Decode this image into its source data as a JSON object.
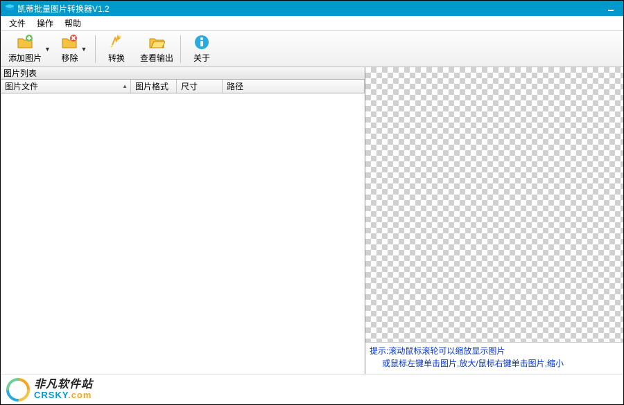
{
  "title": "凯蒂批量图片转换器V1.2",
  "menu": {
    "file": "文件",
    "operate": "操作",
    "help": "帮助"
  },
  "toolbar": {
    "add": "添加图片",
    "remove": "移除",
    "convert": "转换",
    "viewOutput": "查看输出",
    "about": "关于"
  },
  "panel": {
    "listTitle": "图片列表"
  },
  "columns": {
    "file": "图片文件",
    "format": "图片格式",
    "size": "尺寸",
    "path": "路径"
  },
  "hint": {
    "line1": "提示:滚动鼠标滚轮可以缩放显示图片",
    "line2": "或鼠标左键单击图片,放大/鼠标右键单击图片,缩小"
  },
  "footer": {
    "cn": "非凡软件站",
    "en1": "CRSKY",
    "en2": ".com"
  }
}
